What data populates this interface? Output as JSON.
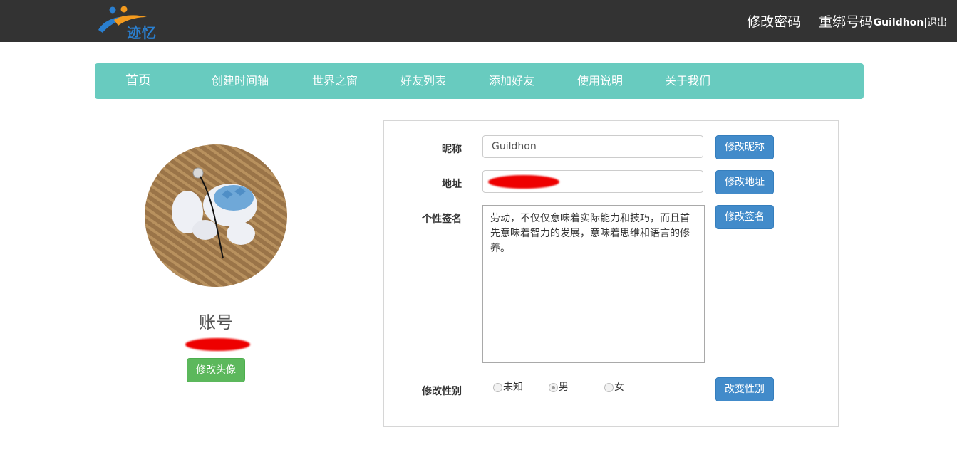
{
  "header": {
    "logo_text": "迹忆",
    "change_password": "修改密码",
    "rebind_number": "重绑号码",
    "username": "Guildhon",
    "separator": "|",
    "logout": "退出"
  },
  "nav": {
    "items": [
      "首页",
      "创建时间轴",
      "世界之窗",
      "好友列表",
      "添加好友",
      "使用说明",
      "关于我们"
    ]
  },
  "profile": {
    "account_label": "账号",
    "change_avatar": "修改头像"
  },
  "form": {
    "nickname_label": "昵称",
    "nickname_value": "Guildhon",
    "change_nickname": "修改昵称",
    "address_label": "地址",
    "change_address": "修改地址",
    "signature_label": "个性签名",
    "signature_value": "劳动，不仅仅意味着实际能力和技巧，而且首先意味着智力的发展，意味着思维和语言的修养。",
    "change_signature": "修改签名",
    "gender_label": "修改性别",
    "gender_options": [
      "未知",
      "男",
      "女"
    ],
    "gender_selected": "男",
    "change_gender": "改变性别"
  },
  "colors": {
    "topbar": "#333333",
    "nav": "#68cbbf",
    "primary_button": "#428bca",
    "success_button": "#5cb85c",
    "redaction": "#ee0000"
  }
}
